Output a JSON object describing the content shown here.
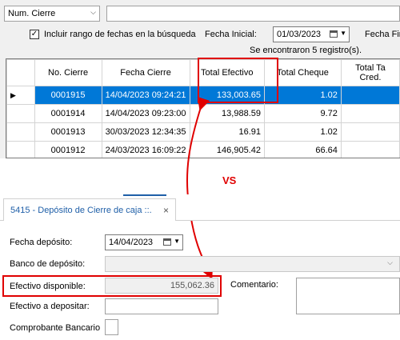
{
  "filter": {
    "field_combo": "Num. Cierre",
    "search_value": "",
    "include_range_label": "Incluir rango de fechas en la búsqueda",
    "include_range_checked": "✓",
    "fecha_inicial_label": "Fecha Inicial:",
    "fecha_inicial_value": "01/03/2023",
    "fecha_final_label": "Fecha Fin",
    "records_found": "Se encontraron 5 registro(s)."
  },
  "grid": {
    "columns": [
      "No. Cierre",
      "Fecha Cierre",
      "Total Efectivo",
      "Total Cheque",
      "Total Ta Cred."
    ],
    "rows": [
      [
        "0001915",
        "14/04/2023 09:24:21",
        "133,003.65",
        "1.02",
        ""
      ],
      [
        "0001914",
        "14/04/2023 09:23:00",
        "13,988.59",
        "9.72",
        ""
      ],
      [
        "0001913",
        "30/03/2023 12:34:35",
        "16.91",
        "1.02",
        ""
      ],
      [
        "0001912",
        "24/03/2023 16:09:22",
        "146,905.42",
        "66.64",
        ""
      ]
    ],
    "selected_row_indicator": "▶"
  },
  "annotation": {
    "vs": "VS",
    "highlight_color": "#e00000"
  },
  "deposit": {
    "tab_title": "5415 - Depósito de Cierre de caja ::.",
    "tab_close": "×",
    "fecha_deposito_label": "Fecha depósito:",
    "fecha_deposito_value": "14/04/2023",
    "banco_label": "Banco de depósito:",
    "banco_value": "",
    "efectivo_disponible_label": "Efectivo disponible:",
    "efectivo_disponible_value": "155,062.36",
    "comentario_label": "Comentario:",
    "efectivo_depositar_label": "Efectivo a depositar:",
    "comprobante_label": "Comprobante Bancario"
  },
  "colors": {
    "selection": "#0078d7",
    "accent_red": "#e00000"
  }
}
